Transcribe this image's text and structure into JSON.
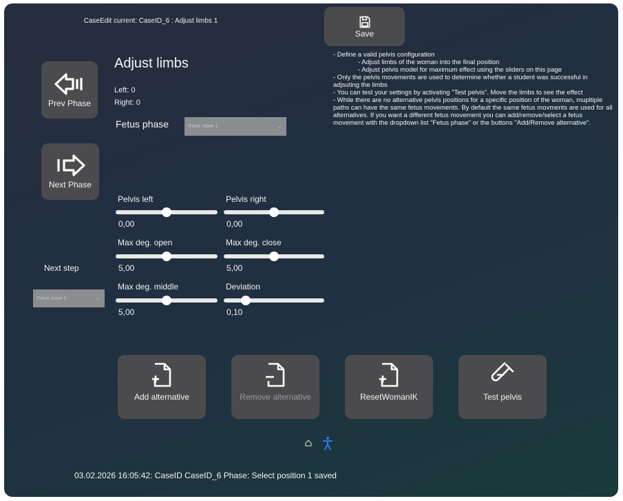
{
  "header": {
    "case_edit": "CaseEdit current: CaseID_6 : Adjust limbs 1"
  },
  "save_button": {
    "label": "Save"
  },
  "nav": {
    "prev_label": "Prev Phase",
    "next_label": "Next Phase"
  },
  "section": {
    "title": "Adjust limbs",
    "left": "Left: 0",
    "right": "Right: 0",
    "fetus_phase_label": "Fetus phase",
    "fetus_phase_value": "Fetus move 1"
  },
  "next_step": {
    "label": "Next step",
    "value": "Fetus move 1"
  },
  "sliders": [
    {
      "label": "Pelvis left",
      "value": "0,00",
      "fraction": 0.5
    },
    {
      "label": "Pelvis right",
      "value": "0,00",
      "fraction": 0.5
    },
    {
      "label": "Max deg. open",
      "value": "5,00",
      "fraction": 0.5
    },
    {
      "label": "Max deg. close",
      "value": "5,00",
      "fraction": 0.5
    },
    {
      "label": "Max deg. middle",
      "value": "5,00",
      "fraction": 0.5
    },
    {
      "label": "Deviation",
      "value": "0,10",
      "fraction": 0.22
    }
  ],
  "instructions": {
    "l1": "- Define a valid pelvis configuration",
    "l2": "- Adjust limbs of the woman into the final position",
    "l3": "- Adjust pelvis model for maximum effect using the sliders on this page",
    "l4": "- Only the pelvis movements are used to determine whether a student was successful in adjsuting the limbs",
    "l5": "- You can test your settings by activating \"Test pelvis\". Move the limbs to see the effect",
    "l6": "- While there are no alternative pelvis positions for a specific position of the woman, mupltiple paths can have the same fetus movements. By default the same fetus movments are used for all alternatives. If you want a different fetus movement you can add/remove/select a fetus movement with the dropdown list \"Fetus phase\" or the buttons \"Add/Remove alternative\"."
  },
  "actions": {
    "add": "Add alternative",
    "remove": "Remove alternative",
    "reset": "ResetWomanIK",
    "test": "Test pelvis"
  },
  "status": {
    "text": "03.02.2026 16:05:42: CaseID CaseID_6 Phase: Select position 1 saved"
  },
  "icons": {
    "save": "save-icon",
    "prev": "arrow-left-icon",
    "next": "arrow-right-icon",
    "add": "file-plus-icon",
    "remove": "file-minus-icon",
    "reset": "file-plus-icon",
    "test": "test-tube-icon",
    "home": "home-icon",
    "accessibility": "accessibility-icon"
  },
  "colors": {
    "accent": "#2f7df0",
    "button": "#4b4b4e",
    "dropdown": "#8b8d90"
  }
}
